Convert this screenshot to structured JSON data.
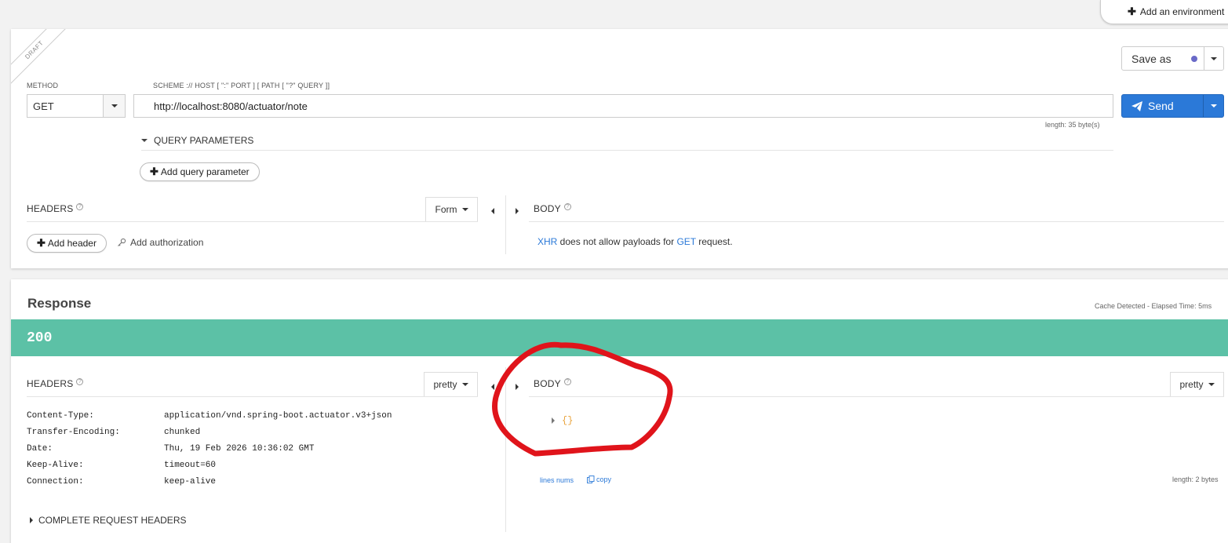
{
  "top": {
    "add_environment_label": "Add an environment"
  },
  "request": {
    "draft_label": "DRAFT",
    "method_label": "METHOD",
    "method_value": "GET",
    "url_label": "SCHEME :// HOST [ \":\" PORT ] [ PATH [ \"?\" QUERY ]]",
    "url_value": "http://localhost:8080/actuator/note",
    "length_info": "length: 35 byte(s)",
    "save_as_label": "Save as",
    "send_label": "Send",
    "query_parameters_label": "QUERY PARAMETERS",
    "add_query_parameter_label": "Add query parameter",
    "headers_label": "HEADERS",
    "form_label": "Form",
    "add_header_label": "Add header",
    "add_authorization_label": "Add authorization",
    "body_label": "BODY",
    "body_msg": {
      "xhr": "XHR",
      "middle": " does not allow payloads for ",
      "method": "GET",
      "end": " request."
    }
  },
  "response": {
    "title": "Response",
    "cache_info": "Cache Detected - Elapsed Time: 5ms",
    "status_code": "200",
    "status_color": "#5cc1a6",
    "headers_label": "HEADERS",
    "headers_format": "pretty",
    "headers": [
      {
        "key": "Content-Type:",
        "value": "application/vnd.spring-boot.actuator.v3+json"
      },
      {
        "key": "Transfer-Encoding:",
        "value": "chunked"
      },
      {
        "key": "Date:",
        "value": "Thu, 19 Feb 2026 10:36:02 GMT"
      },
      {
        "key": "Keep-Alive:",
        "value": "timeout=60"
      },
      {
        "key": "Connection:",
        "value": "keep-alive"
      }
    ],
    "complete_request_headers_label": "COMPLETE REQUEST HEADERS",
    "body_label": "BODY",
    "body_format": "pretty",
    "body_json": "{}",
    "lines_nums_label": "lines nums",
    "copy_label": "copy",
    "body_length": "length: 2 bytes"
  },
  "colors": {
    "accent": "#2b79d8",
    "annotation": "#e0141b"
  }
}
